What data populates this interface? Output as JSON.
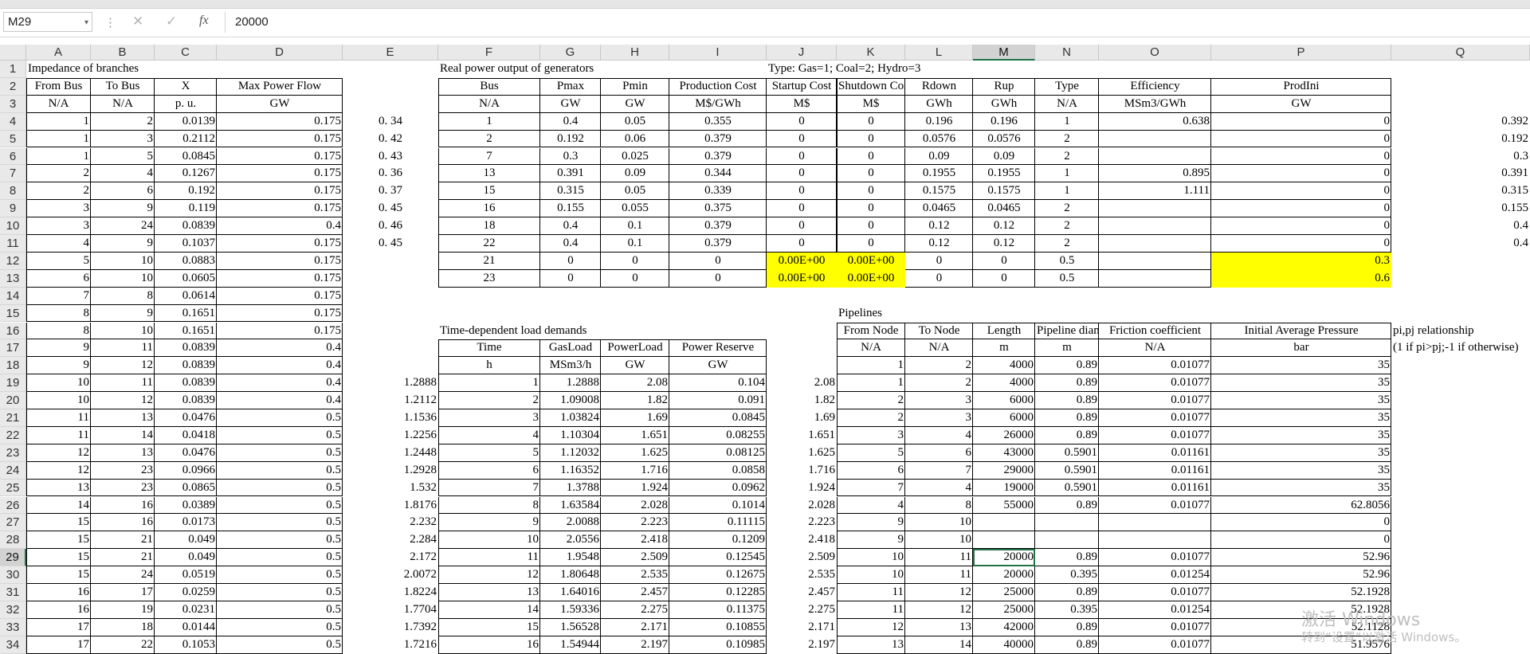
{
  "formula_bar": {
    "name_box": "M29",
    "value": "20000",
    "fx": "fx"
  },
  "col_headers": [
    "A",
    "B",
    "C",
    "D",
    "E",
    "F",
    "G",
    "H",
    "I",
    "J",
    "K",
    "L",
    "M",
    "N",
    "O",
    "P",
    "Q"
  ],
  "selected_col": "M",
  "selected_row": 29,
  "active_cell": "M29",
  "highlight_color": "#ffff00",
  "row_numbers": [
    "1",
    "2",
    "3",
    "4",
    "5",
    "6",
    "7",
    "8",
    "9",
    "10",
    "11",
    "12",
    "13",
    "14",
    "15",
    "16",
    "17",
    "18",
    "19",
    "20",
    "21",
    "22",
    "23",
    "24",
    "25",
    "26",
    "27",
    "28",
    "29",
    "30",
    "31",
    "32",
    "33",
    "34"
  ],
  "cells": [
    [
      "A1",
      "Impedance of branches"
    ],
    [
      "F1",
      "Real power output of generators"
    ],
    [
      "J1",
      "Type: Gas=1; Coal=2; Hydro=3"
    ],
    [
      "A2",
      "From Bus"
    ],
    [
      "B2",
      "To Bus"
    ],
    [
      "C2",
      "X"
    ],
    [
      "D2",
      "Max Power Flow"
    ],
    [
      "F2",
      "Bus"
    ],
    [
      "G2",
      "Pmax"
    ],
    [
      "H2",
      "Pmin"
    ],
    [
      "I2",
      "Production Cost"
    ],
    [
      "J2",
      "Startup Cost"
    ],
    [
      "K2",
      "Shutdown Cost"
    ],
    [
      "L2",
      "Rdown"
    ],
    [
      "M2",
      "Rup"
    ],
    [
      "N2",
      "Type"
    ],
    [
      "O2",
      "Efficiency"
    ],
    [
      "P2",
      "ProdIni"
    ],
    [
      "A3",
      "N/A"
    ],
    [
      "B3",
      "N/A"
    ],
    [
      "C3",
      "p. u."
    ],
    [
      "D3",
      "GW"
    ],
    [
      "F3",
      "N/A"
    ],
    [
      "G3",
      "GW"
    ],
    [
      "H3",
      "GW"
    ],
    [
      "I3",
      "M$/GWh"
    ],
    [
      "J3",
      "M$"
    ],
    [
      "K3",
      "M$"
    ],
    [
      "L3",
      "GWh"
    ],
    [
      "M3",
      "GWh"
    ],
    [
      "N3",
      "N/A"
    ],
    [
      "O3",
      "MSm3/GWh"
    ],
    [
      "P3",
      "GW"
    ],
    [
      "A4",
      "1"
    ],
    [
      "B4",
      "2"
    ],
    [
      "C4",
      "0.0139"
    ],
    [
      "D4",
      "0.175"
    ],
    [
      "E4",
      "0. 34"
    ],
    [
      "F4",
      "1"
    ],
    [
      "G4",
      "0.4"
    ],
    [
      "H4",
      "0.05"
    ],
    [
      "I4",
      "0.355"
    ],
    [
      "J4",
      "0"
    ],
    [
      "K4",
      "0"
    ],
    [
      "L4",
      "0.196"
    ],
    [
      "M4",
      "0.196"
    ],
    [
      "N4",
      "1"
    ],
    [
      "O4",
      "0.638"
    ],
    [
      "P4",
      "0"
    ],
    [
      "Q4",
      "0.392"
    ],
    [
      "A5",
      "1"
    ],
    [
      "B5",
      "3"
    ],
    [
      "C5",
      "0.2112"
    ],
    [
      "D5",
      "0.175"
    ],
    [
      "E5",
      "0. 42"
    ],
    [
      "F5",
      "2"
    ],
    [
      "G5",
      "0.192"
    ],
    [
      "H5",
      "0.06"
    ],
    [
      "I5",
      "0.379"
    ],
    [
      "J5",
      "0"
    ],
    [
      "K5",
      "0"
    ],
    [
      "L5",
      "0.0576"
    ],
    [
      "M5",
      "0.0576"
    ],
    [
      "N5",
      "2"
    ],
    [
      "P5",
      "0"
    ],
    [
      "Q5",
      "0.192"
    ],
    [
      "A6",
      "1"
    ],
    [
      "B6",
      "5"
    ],
    [
      "C6",
      "0.0845"
    ],
    [
      "D6",
      "0.175"
    ],
    [
      "E6",
      "0. 43"
    ],
    [
      "F6",
      "7"
    ],
    [
      "G6",
      "0.3"
    ],
    [
      "H6",
      "0.025"
    ],
    [
      "I6",
      "0.379"
    ],
    [
      "J6",
      "0"
    ],
    [
      "K6",
      "0"
    ],
    [
      "L6",
      "0.09"
    ],
    [
      "M6",
      "0.09"
    ],
    [
      "N6",
      "2"
    ],
    [
      "P6",
      "0"
    ],
    [
      "Q6",
      "0.3"
    ],
    [
      "A7",
      "2"
    ],
    [
      "B7",
      "4"
    ],
    [
      "C7",
      "0.1267"
    ],
    [
      "D7",
      "0.175"
    ],
    [
      "E7",
      "0. 36"
    ],
    [
      "F7",
      "13"
    ],
    [
      "G7",
      "0.391"
    ],
    [
      "H7",
      "0.09"
    ],
    [
      "I7",
      "0.344"
    ],
    [
      "J7",
      "0"
    ],
    [
      "K7",
      "0"
    ],
    [
      "L7",
      "0.1955"
    ],
    [
      "M7",
      "0.1955"
    ],
    [
      "N7",
      "1"
    ],
    [
      "O7",
      "0.895"
    ],
    [
      "P7",
      "0"
    ],
    [
      "Q7",
      "0.391"
    ],
    [
      "A8",
      "2"
    ],
    [
      "B8",
      "6"
    ],
    [
      "C8",
      "0.192"
    ],
    [
      "D8",
      "0.175"
    ],
    [
      "E8",
      "0. 37"
    ],
    [
      "F8",
      "15"
    ],
    [
      "G8",
      "0.315"
    ],
    [
      "H8",
      "0.05"
    ],
    [
      "I8",
      "0.339"
    ],
    [
      "J8",
      "0"
    ],
    [
      "K8",
      "0"
    ],
    [
      "L8",
      "0.1575"
    ],
    [
      "M8",
      "0.1575"
    ],
    [
      "N8",
      "1"
    ],
    [
      "O8",
      "1.111"
    ],
    [
      "P8",
      "0"
    ],
    [
      "Q8",
      "0.315"
    ],
    [
      "A9",
      "3"
    ],
    [
      "B9",
      "9"
    ],
    [
      "C9",
      "0.119"
    ],
    [
      "D9",
      "0.175"
    ],
    [
      "E9",
      "0. 45"
    ],
    [
      "F9",
      "16"
    ],
    [
      "G9",
      "0.155"
    ],
    [
      "H9",
      "0.055"
    ],
    [
      "I9",
      "0.375"
    ],
    [
      "J9",
      "0"
    ],
    [
      "K9",
      "0"
    ],
    [
      "L9",
      "0.0465"
    ],
    [
      "M9",
      "0.0465"
    ],
    [
      "N9",
      "2"
    ],
    [
      "P9",
      "0"
    ],
    [
      "Q9",
      "0.155"
    ],
    [
      "A10",
      "3"
    ],
    [
      "B10",
      "24"
    ],
    [
      "C10",
      "0.0839"
    ],
    [
      "D10",
      "0.4"
    ],
    [
      "E10",
      "0. 46"
    ],
    [
      "F10",
      "18"
    ],
    [
      "G10",
      "0.4"
    ],
    [
      "H10",
      "0.1"
    ],
    [
      "I10",
      "0.379"
    ],
    [
      "J10",
      "0"
    ],
    [
      "K10",
      "0"
    ],
    [
      "L10",
      "0.12"
    ],
    [
      "M10",
      "0.12"
    ],
    [
      "N10",
      "2"
    ],
    [
      "P10",
      "0"
    ],
    [
      "Q10",
      "0.4"
    ],
    [
      "A11",
      "4"
    ],
    [
      "B11",
      "9"
    ],
    [
      "C11",
      "0.1037"
    ],
    [
      "D11",
      "0.175"
    ],
    [
      "E11",
      "0. 45"
    ],
    [
      "F11",
      "22"
    ],
    [
      "G11",
      "0.4"
    ],
    [
      "H11",
      "0.1"
    ],
    [
      "I11",
      "0.379"
    ],
    [
      "J11",
      "0"
    ],
    [
      "K11",
      "0"
    ],
    [
      "L11",
      "0.12"
    ],
    [
      "M11",
      "0.12"
    ],
    [
      "N11",
      "2"
    ],
    [
      "P11",
      "0"
    ],
    [
      "Q11",
      "0.4"
    ],
    [
      "A12",
      "5"
    ],
    [
      "B12",
      "10"
    ],
    [
      "C12",
      "0.0883"
    ],
    [
      "D12",
      "0.175"
    ],
    [
      "F12",
      "21"
    ],
    [
      "G12",
      "0"
    ],
    [
      "H12",
      "0"
    ],
    [
      "I12",
      "0"
    ],
    [
      "J12",
      "0.00E+00"
    ],
    [
      "K12",
      "0.00E+00"
    ],
    [
      "L12",
      "0"
    ],
    [
      "M12",
      "0"
    ],
    [
      "N12",
      "0.5"
    ],
    [
      "P12",
      "0.3"
    ],
    [
      "A13",
      "6"
    ],
    [
      "B13",
      "10"
    ],
    [
      "C13",
      "0.0605"
    ],
    [
      "D13",
      "0.175"
    ],
    [
      "F13",
      "23"
    ],
    [
      "G13",
      "0"
    ],
    [
      "H13",
      "0"
    ],
    [
      "I13",
      "0"
    ],
    [
      "J13",
      "0.00E+00"
    ],
    [
      "K13",
      "0.00E+00"
    ],
    [
      "L13",
      "0"
    ],
    [
      "M13",
      "0"
    ],
    [
      "N13",
      "0.5"
    ],
    [
      "P13",
      "0.6"
    ],
    [
      "A14",
      "7"
    ],
    [
      "B14",
      "8"
    ],
    [
      "C14",
      "0.0614"
    ],
    [
      "D14",
      "0.175"
    ],
    [
      "A15",
      "8"
    ],
    [
      "B15",
      "9"
    ],
    [
      "C15",
      "0.1651"
    ],
    [
      "D15",
      "0.175"
    ],
    [
      "K15",
      "Pipelines"
    ],
    [
      "A16",
      "8"
    ],
    [
      "B16",
      "10"
    ],
    [
      "C16",
      "0.1651"
    ],
    [
      "D16",
      "0.175"
    ],
    [
      "F16",
      "Time-dependent load demands"
    ],
    [
      "K16",
      "From Node"
    ],
    [
      "L16",
      "To Node"
    ],
    [
      "M16",
      "Length"
    ],
    [
      "N16",
      "Pipeline diameter"
    ],
    [
      "O16",
      "Friction coefficient"
    ],
    [
      "P16",
      "Initial Average Pressure"
    ],
    [
      "Q16",
      "pi,pj relationship"
    ],
    [
      "A17",
      "9"
    ],
    [
      "B17",
      "11"
    ],
    [
      "C17",
      "0.0839"
    ],
    [
      "D17",
      "0.4"
    ],
    [
      "F17",
      "Time"
    ],
    [
      "G17",
      "GasLoad"
    ],
    [
      "H17",
      "PowerLoad"
    ],
    [
      "I17",
      "Power Reserve"
    ],
    [
      "K17",
      "N/A"
    ],
    [
      "L17",
      "N/A"
    ],
    [
      "M17",
      "m"
    ],
    [
      "N17",
      "m"
    ],
    [
      "O17",
      "N/A"
    ],
    [
      "P17",
      "bar"
    ],
    [
      "Q17",
      "(1 if pi>pj;-1 if otherwise)"
    ],
    [
      "A18",
      "9"
    ],
    [
      "B18",
      "12"
    ],
    [
      "C18",
      "0.0839"
    ],
    [
      "D18",
      "0.4"
    ],
    [
      "F18",
      "h"
    ],
    [
      "G18",
      "MSm3/h"
    ],
    [
      "H18",
      "GW"
    ],
    [
      "I18",
      "GW"
    ],
    [
      "K18",
      "1"
    ],
    [
      "L18",
      "2"
    ],
    [
      "M18",
      "4000"
    ],
    [
      "N18",
      "0.89"
    ],
    [
      "O18",
      "0.01077"
    ],
    [
      "P18",
      "35"
    ],
    [
      "A19",
      "10"
    ],
    [
      "B19",
      "11"
    ],
    [
      "C19",
      "0.0839"
    ],
    [
      "D19",
      "0.4"
    ],
    [
      "E19",
      "1.2888"
    ],
    [
      "F19",
      "1"
    ],
    [
      "G19",
      "1.2888"
    ],
    [
      "H19",
      "2.08"
    ],
    [
      "I19",
      "0.104"
    ],
    [
      "J19",
      "2.08"
    ],
    [
      "K19",
      "1"
    ],
    [
      "L19",
      "2"
    ],
    [
      "M19",
      "4000"
    ],
    [
      "N19",
      "0.89"
    ],
    [
      "O19",
      "0.01077"
    ],
    [
      "P19",
      "35"
    ],
    [
      "A20",
      "10"
    ],
    [
      "B20",
      "12"
    ],
    [
      "C20",
      "0.0839"
    ],
    [
      "D20",
      "0.4"
    ],
    [
      "E20",
      "1.2112"
    ],
    [
      "F20",
      "2"
    ],
    [
      "G20",
      "1.09008"
    ],
    [
      "H20",
      "1.82"
    ],
    [
      "I20",
      "0.091"
    ],
    [
      "J20",
      "1.82"
    ],
    [
      "K20",
      "2"
    ],
    [
      "L20",
      "3"
    ],
    [
      "M20",
      "6000"
    ],
    [
      "N20",
      "0.89"
    ],
    [
      "O20",
      "0.01077"
    ],
    [
      "P20",
      "35"
    ],
    [
      "A21",
      "11"
    ],
    [
      "B21",
      "13"
    ],
    [
      "C21",
      "0.0476"
    ],
    [
      "D21",
      "0.5"
    ],
    [
      "E21",
      "1.1536"
    ],
    [
      "F21",
      "3"
    ],
    [
      "G21",
      "1.03824"
    ],
    [
      "H21",
      "1.69"
    ],
    [
      "I21",
      "0.0845"
    ],
    [
      "J21",
      "1.69"
    ],
    [
      "K21",
      "2"
    ],
    [
      "L21",
      "3"
    ],
    [
      "M21",
      "6000"
    ],
    [
      "N21",
      "0.89"
    ],
    [
      "O21",
      "0.01077"
    ],
    [
      "P21",
      "35"
    ],
    [
      "A22",
      "11"
    ],
    [
      "B22",
      "14"
    ],
    [
      "C22",
      "0.0418"
    ],
    [
      "D22",
      "0.5"
    ],
    [
      "E22",
      "1.2256"
    ],
    [
      "F22",
      "4"
    ],
    [
      "G22",
      "1.10304"
    ],
    [
      "H22",
      "1.651"
    ],
    [
      "I22",
      "0.08255"
    ],
    [
      "J22",
      "1.651"
    ],
    [
      "K22",
      "3"
    ],
    [
      "L22",
      "4"
    ],
    [
      "M22",
      "26000"
    ],
    [
      "N22",
      "0.89"
    ],
    [
      "O22",
      "0.01077"
    ],
    [
      "P22",
      "35"
    ],
    [
      "A23",
      "12"
    ],
    [
      "B23",
      "13"
    ],
    [
      "C23",
      "0.0476"
    ],
    [
      "D23",
      "0.5"
    ],
    [
      "E23",
      "1.2448"
    ],
    [
      "F23",
      "5"
    ],
    [
      "G23",
      "1.12032"
    ],
    [
      "H23",
      "1.625"
    ],
    [
      "I23",
      "0.08125"
    ],
    [
      "J23",
      "1.625"
    ],
    [
      "K23",
      "5"
    ],
    [
      "L23",
      "6"
    ],
    [
      "M23",
      "43000"
    ],
    [
      "N23",
      "0.5901"
    ],
    [
      "O23",
      "0.01161"
    ],
    [
      "P23",
      "35"
    ],
    [
      "A24",
      "12"
    ],
    [
      "B24",
      "23"
    ],
    [
      "C24",
      "0.0966"
    ],
    [
      "D24",
      "0.5"
    ],
    [
      "E24",
      "1.2928"
    ],
    [
      "F24",
      "6"
    ],
    [
      "G24",
      "1.16352"
    ],
    [
      "H24",
      "1.716"
    ],
    [
      "I24",
      "0.0858"
    ],
    [
      "J24",
      "1.716"
    ],
    [
      "K24",
      "6"
    ],
    [
      "L24",
      "7"
    ],
    [
      "M24",
      "29000"
    ],
    [
      "N24",
      "0.5901"
    ],
    [
      "O24",
      "0.01161"
    ],
    [
      "P24",
      "35"
    ],
    [
      "A25",
      "13"
    ],
    [
      "B25",
      "23"
    ],
    [
      "C25",
      "0.0865"
    ],
    [
      "D25",
      "0.5"
    ],
    [
      "E25",
      "1.532"
    ],
    [
      "F25",
      "7"
    ],
    [
      "G25",
      "1.3788"
    ],
    [
      "H25",
      "1.924"
    ],
    [
      "I25",
      "0.0962"
    ],
    [
      "J25",
      "1.924"
    ],
    [
      "K25",
      "7"
    ],
    [
      "L25",
      "4"
    ],
    [
      "M25",
      "19000"
    ],
    [
      "N25",
      "0.5901"
    ],
    [
      "O25",
      "0.01161"
    ],
    [
      "P25",
      "35"
    ],
    [
      "A26",
      "14"
    ],
    [
      "B26",
      "16"
    ],
    [
      "C26",
      "0.0389"
    ],
    [
      "D26",
      "0.5"
    ],
    [
      "E26",
      "1.8176"
    ],
    [
      "F26",
      "8"
    ],
    [
      "G26",
      "1.63584"
    ],
    [
      "H26",
      "2.028"
    ],
    [
      "I26",
      "0.1014"
    ],
    [
      "J26",
      "2.028"
    ],
    [
      "K26",
      "4"
    ],
    [
      "L26",
      "8"
    ],
    [
      "M26",
      "55000"
    ],
    [
      "N26",
      "0.89"
    ],
    [
      "O26",
      "0.01077"
    ],
    [
      "P26",
      "62.8056"
    ],
    [
      "A27",
      "15"
    ],
    [
      "B27",
      "16"
    ],
    [
      "C27",
      "0.0173"
    ],
    [
      "D27",
      "0.5"
    ],
    [
      "E27",
      "2.232"
    ],
    [
      "F27",
      "9"
    ],
    [
      "G27",
      "2.0088"
    ],
    [
      "H27",
      "2.223"
    ],
    [
      "I27",
      "0.11115"
    ],
    [
      "J27",
      "2.223"
    ],
    [
      "K27",
      "9"
    ],
    [
      "L27",
      "10"
    ],
    [
      "P27",
      "0"
    ],
    [
      "A28",
      "15"
    ],
    [
      "B28",
      "21"
    ],
    [
      "C28",
      "0.049"
    ],
    [
      "D28",
      "0.5"
    ],
    [
      "E28",
      "2.284"
    ],
    [
      "F28",
      "10"
    ],
    [
      "G28",
      "2.0556"
    ],
    [
      "H28",
      "2.418"
    ],
    [
      "I28",
      "0.1209"
    ],
    [
      "J28",
      "2.418"
    ],
    [
      "K28",
      "9"
    ],
    [
      "L28",
      "10"
    ],
    [
      "P28",
      "0"
    ],
    [
      "A29",
      "15"
    ],
    [
      "B29",
      "21"
    ],
    [
      "C29",
      "0.049"
    ],
    [
      "D29",
      "0.5"
    ],
    [
      "E29",
      "2.172"
    ],
    [
      "F29",
      "11"
    ],
    [
      "G29",
      "1.9548"
    ],
    [
      "H29",
      "2.509"
    ],
    [
      "I29",
      "0.12545"
    ],
    [
      "J29",
      "2.509"
    ],
    [
      "K29",
      "10"
    ],
    [
      "L29",
      "11"
    ],
    [
      "M29",
      "20000"
    ],
    [
      "N29",
      "0.89"
    ],
    [
      "O29",
      "0.01077"
    ],
    [
      "P29",
      "52.96"
    ],
    [
      "A30",
      "15"
    ],
    [
      "B30",
      "24"
    ],
    [
      "C30",
      "0.0519"
    ],
    [
      "D30",
      "0.5"
    ],
    [
      "E30",
      "2.0072"
    ],
    [
      "F30",
      "12"
    ],
    [
      "G30",
      "1.80648"
    ],
    [
      "H30",
      "2.535"
    ],
    [
      "I30",
      "0.12675"
    ],
    [
      "J30",
      "2.535"
    ],
    [
      "K30",
      "10"
    ],
    [
      "L30",
      "11"
    ],
    [
      "M30",
      "20000"
    ],
    [
      "N30",
      "0.395"
    ],
    [
      "O30",
      "0.01254"
    ],
    [
      "P30",
      "52.96"
    ],
    [
      "A31",
      "16"
    ],
    [
      "B31",
      "17"
    ],
    [
      "C31",
      "0.0259"
    ],
    [
      "D31",
      "0.5"
    ],
    [
      "E31",
      "1.8224"
    ],
    [
      "F31",
      "13"
    ],
    [
      "G31",
      "1.64016"
    ],
    [
      "H31",
      "2.457"
    ],
    [
      "I31",
      "0.12285"
    ],
    [
      "J31",
      "2.457"
    ],
    [
      "K31",
      "11"
    ],
    [
      "L31",
      "12"
    ],
    [
      "M31",
      "25000"
    ],
    [
      "N31",
      "0.89"
    ],
    [
      "O31",
      "0.01077"
    ],
    [
      "P31",
      "52.1928"
    ],
    [
      "A32",
      "16"
    ],
    [
      "B32",
      "19"
    ],
    [
      "C32",
      "0.0231"
    ],
    [
      "D32",
      "0.5"
    ],
    [
      "E32",
      "1.7704"
    ],
    [
      "F32",
      "14"
    ],
    [
      "G32",
      "1.59336"
    ],
    [
      "H32",
      "2.275"
    ],
    [
      "I32",
      "0.11375"
    ],
    [
      "J32",
      "2.275"
    ],
    [
      "K32",
      "11"
    ],
    [
      "L32",
      "12"
    ],
    [
      "M32",
      "25000"
    ],
    [
      "N32",
      "0.395"
    ],
    [
      "O32",
      "0.01254"
    ],
    [
      "P32",
      "52.1928"
    ],
    [
      "A33",
      "17"
    ],
    [
      "B33",
      "18"
    ],
    [
      "C33",
      "0.0144"
    ],
    [
      "D33",
      "0.5"
    ],
    [
      "E33",
      "1.7392"
    ],
    [
      "F33",
      "15"
    ],
    [
      "G33",
      "1.56528"
    ],
    [
      "H33",
      "2.171"
    ],
    [
      "I33",
      "0.10855"
    ],
    [
      "J33",
      "2.171"
    ],
    [
      "K33",
      "12"
    ],
    [
      "L33",
      "13"
    ],
    [
      "M33",
      "42000"
    ],
    [
      "N33",
      "0.89"
    ],
    [
      "O33",
      "0.01077"
    ],
    [
      "P33",
      "52.1128"
    ],
    [
      "A34",
      "17"
    ],
    [
      "B34",
      "22"
    ],
    [
      "C34",
      "0.1053"
    ],
    [
      "D34",
      "0.5"
    ],
    [
      "E34",
      "1.7216"
    ],
    [
      "F34",
      "16"
    ],
    [
      "G34",
      "1.54944"
    ],
    [
      "H34",
      "2.197"
    ],
    [
      "I34",
      "0.10985"
    ],
    [
      "J34",
      "2.197"
    ],
    [
      "K34",
      "13"
    ],
    [
      "L34",
      "14"
    ],
    [
      "M34",
      "40000"
    ],
    [
      "N34",
      "0.89"
    ],
    [
      "O34",
      "0.01077"
    ],
    [
      "P34",
      "51.9576"
    ]
  ],
  "watermark": {
    "line1": "激活 Windows",
    "line2": "转到“设置”以激活 Windows。"
  }
}
